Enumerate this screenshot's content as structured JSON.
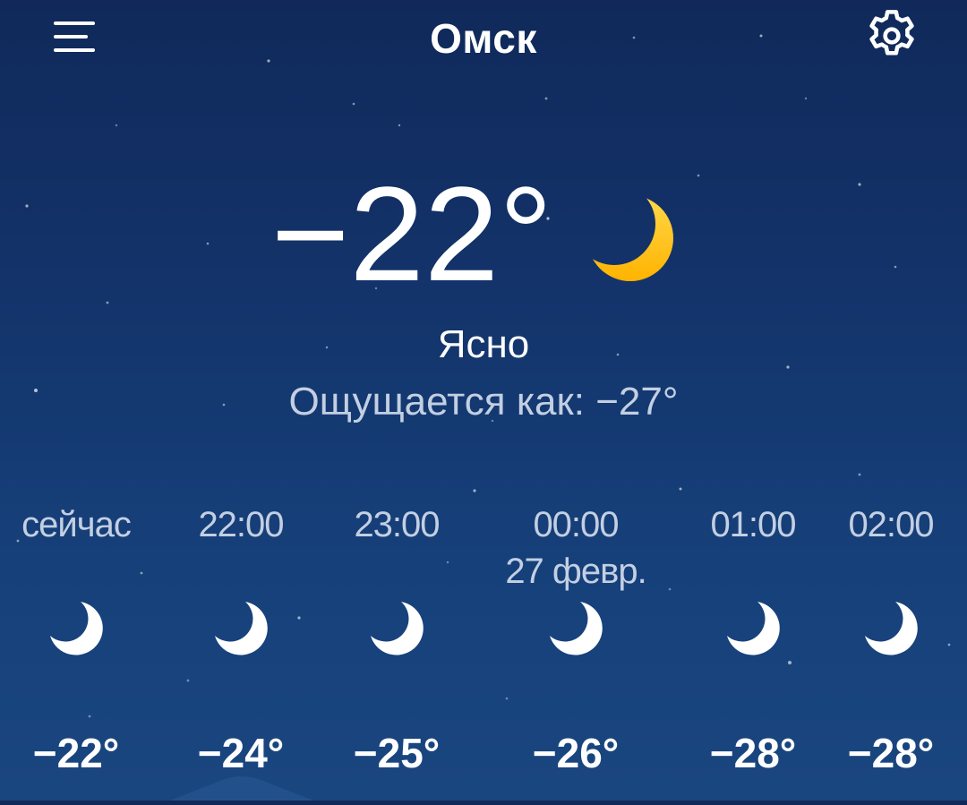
{
  "header": {
    "city": "Омск",
    "menu_icon": "hamburger-menu-icon",
    "settings_icon": "gear-icon"
  },
  "current": {
    "temperature": "−22°",
    "condition": "Ясно",
    "feels_like": "Ощущается как: −27°",
    "icon": "moon-icon"
  },
  "hourly": [
    {
      "time": "сейчас",
      "date": "",
      "icon": "moon-icon",
      "temp": "−22°"
    },
    {
      "time": "22:00",
      "date": "",
      "icon": "moon-icon",
      "temp": "−24°"
    },
    {
      "time": "23:00",
      "date": "",
      "icon": "moon-icon",
      "temp": "−25°"
    },
    {
      "time": "00:00",
      "date": "27 февр.",
      "icon": "moon-icon",
      "temp": "−26°"
    },
    {
      "time": "01:00",
      "date": "",
      "icon": "moon-icon",
      "temp": "−28°"
    },
    {
      "time": "02:00",
      "date": "",
      "icon": "moon-icon",
      "temp": "−28°"
    }
  ],
  "colors": {
    "background_top": "#10295a",
    "background_bottom": "#1a4680",
    "moon_accent": "#ffc21a",
    "secondary_text": "#c3cfe2"
  }
}
